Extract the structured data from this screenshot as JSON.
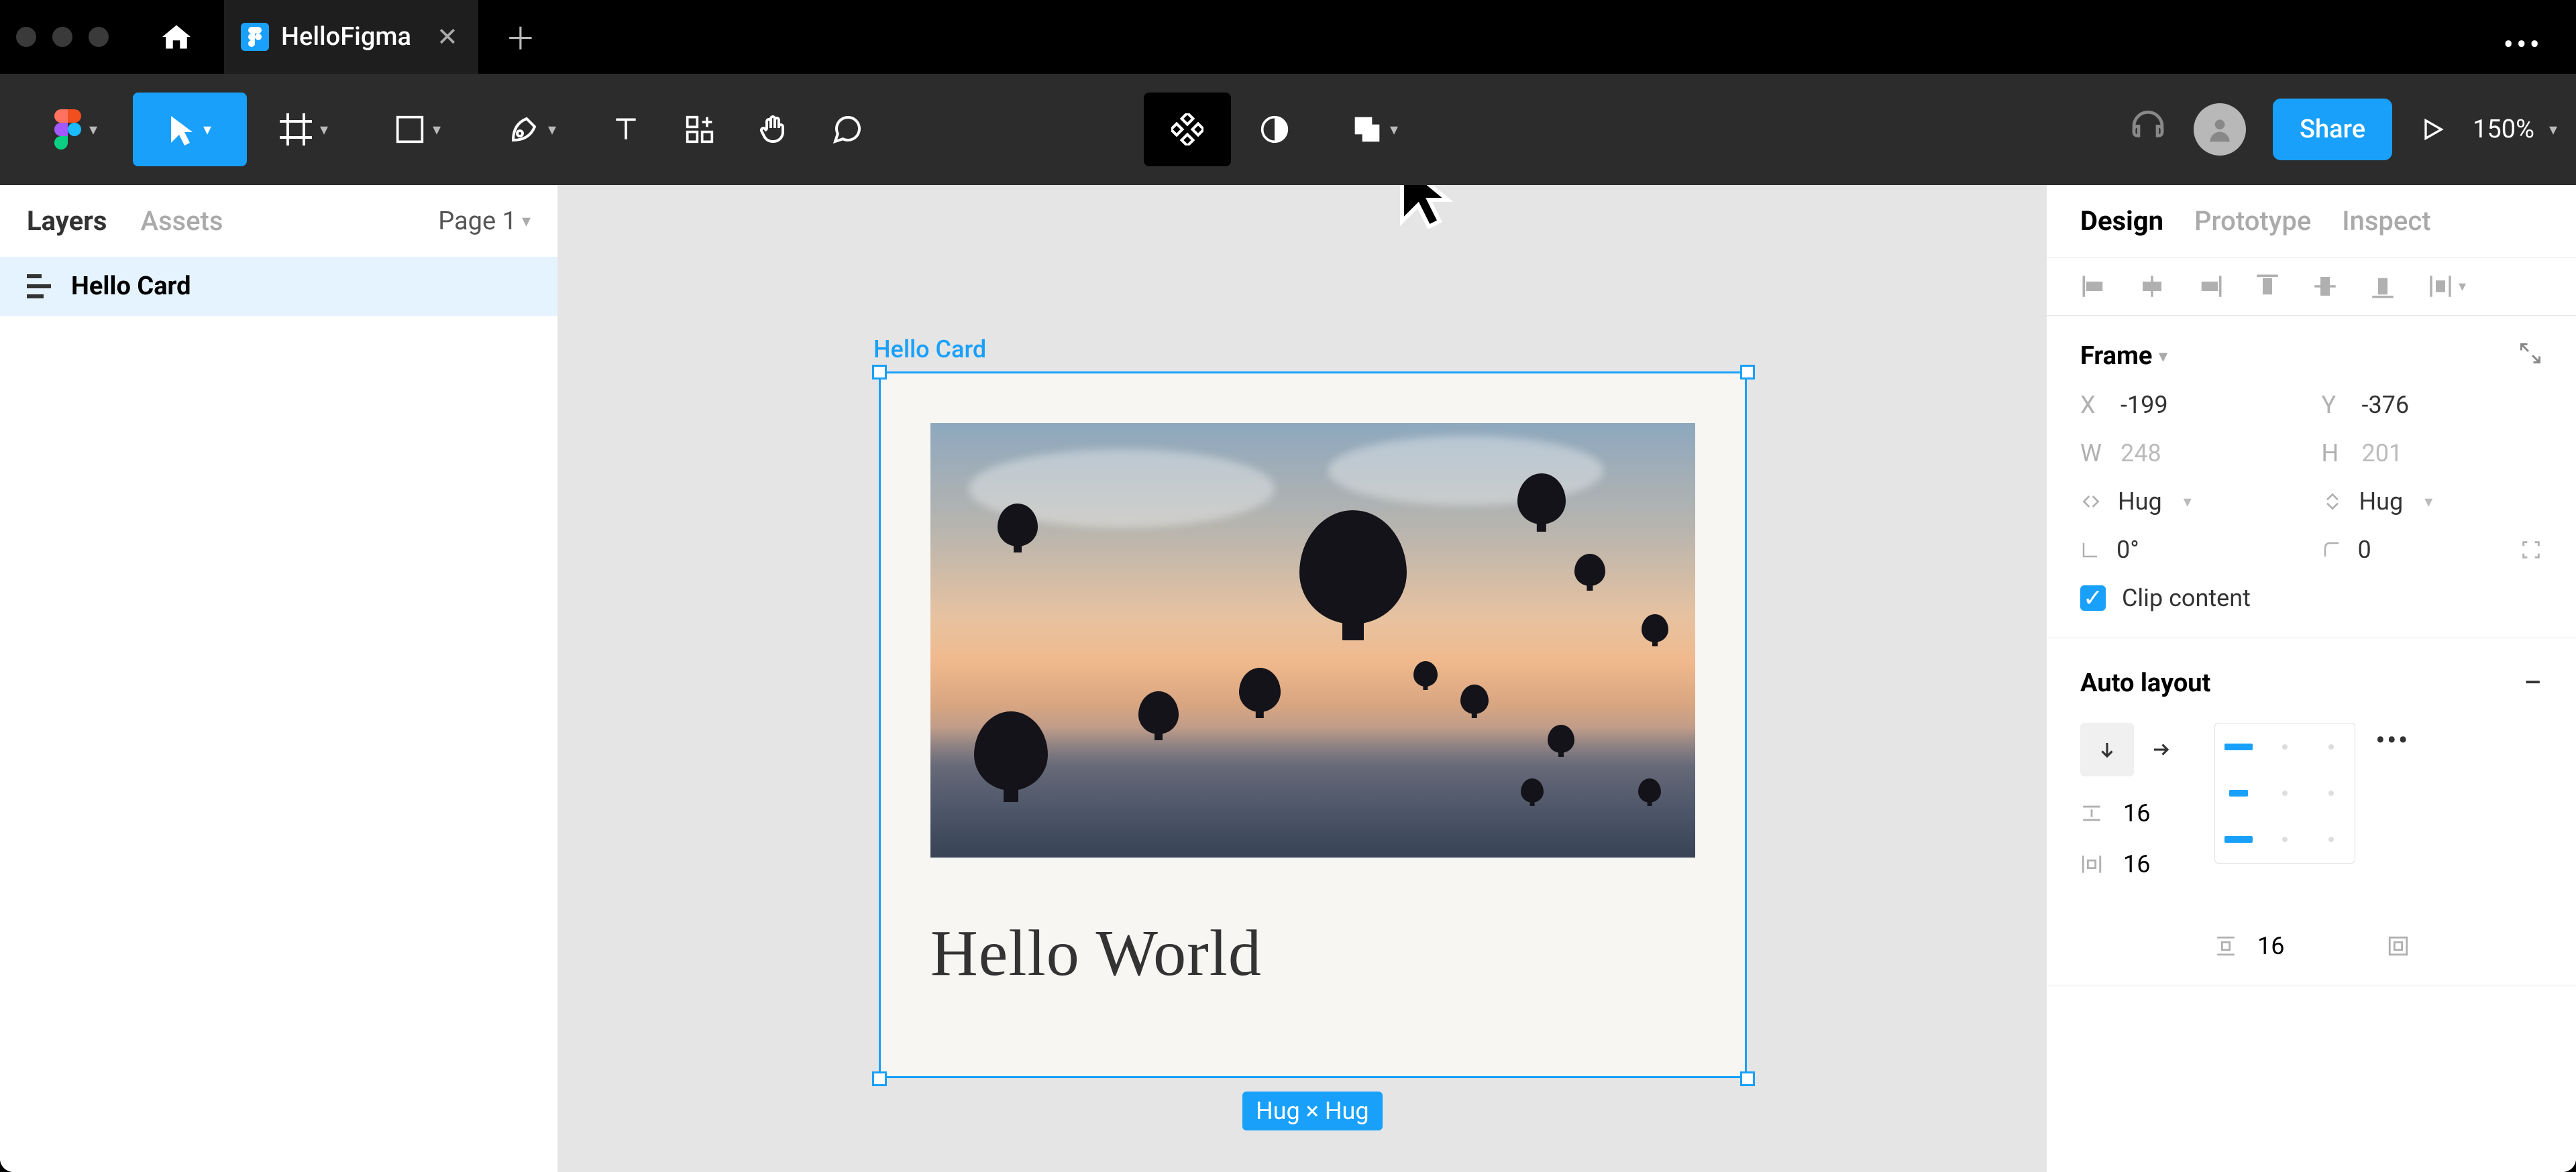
{
  "titlebar": {
    "tab_title": "HelloFigma"
  },
  "toolbar": {
    "share_label": "Share",
    "zoom": "150%"
  },
  "left_panel": {
    "tabs": {
      "layers": "Layers",
      "assets": "Assets"
    },
    "page_label": "Page 1",
    "layer_name": "Hello Card"
  },
  "canvas": {
    "selection_label": "Hello Card",
    "card_text": "Hello World",
    "dimension_badge": "Hug × Hug"
  },
  "right_panel": {
    "tabs": {
      "design": "Design",
      "prototype": "Prototype",
      "inspect": "Inspect"
    },
    "frame": {
      "title": "Frame",
      "x_label": "X",
      "x_value": "-199",
      "y_label": "Y",
      "y_value": "-376",
      "w_label": "W",
      "w_value": "248",
      "h_label": "H",
      "h_value": "201",
      "resize_w": "Hug",
      "resize_h": "Hug",
      "rotation": "0°",
      "corner_radius": "0",
      "clip_label": "Clip content"
    },
    "autolayout": {
      "title": "Auto layout",
      "gap": "16",
      "pad_h": "16",
      "pad_v": "16"
    }
  }
}
